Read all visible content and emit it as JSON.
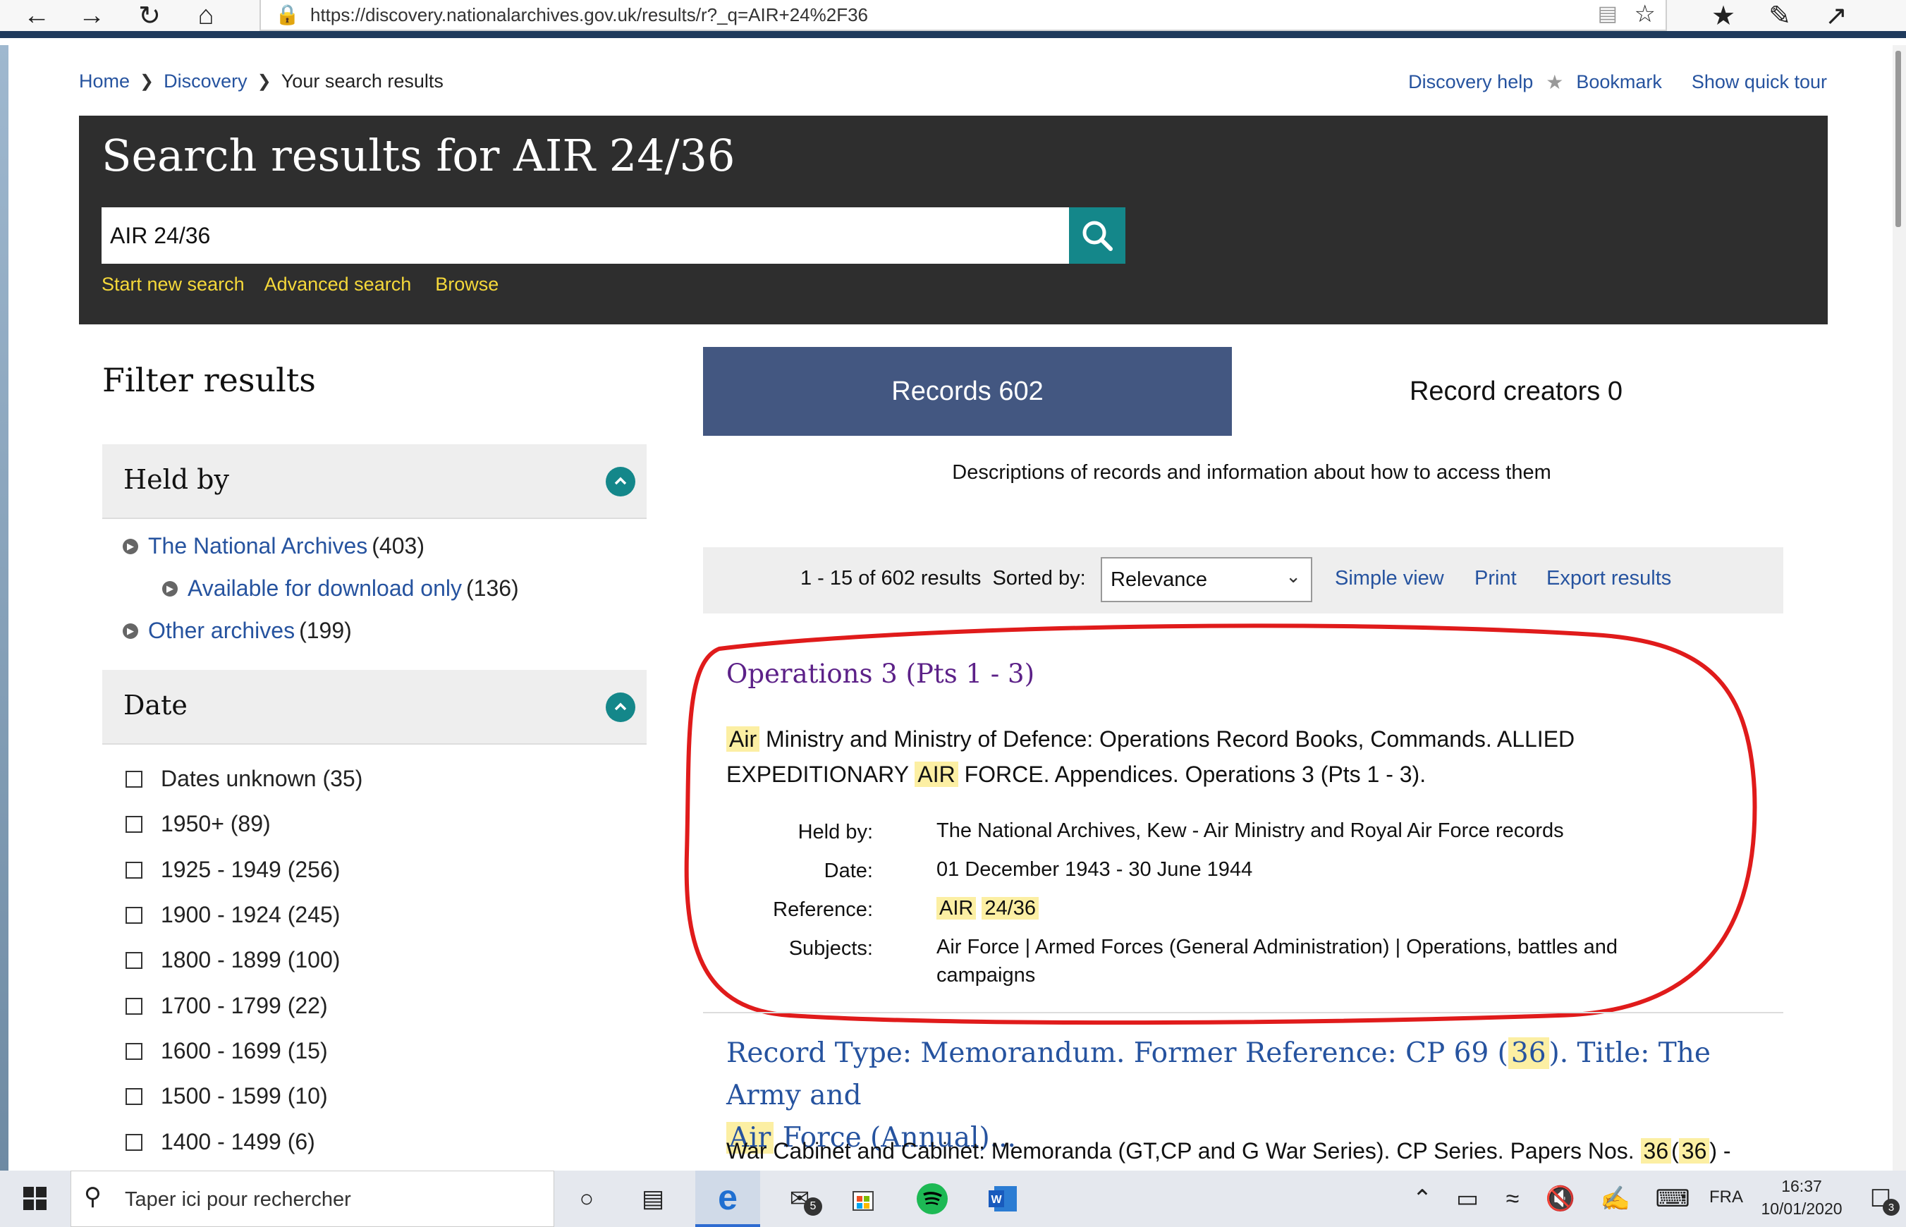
{
  "browser": {
    "url": "https://discovery.nationalarchives.gov.uk/results/r?_q=AIR+24%2F36"
  },
  "breadcrumb": {
    "home": "Home",
    "discovery": "Discovery",
    "current": "Your search results"
  },
  "topnav": {
    "help": "Discovery help",
    "bookmark": "Bookmark",
    "tour": "Show quick tour"
  },
  "hero": {
    "title": "Search results for AIR 24/36",
    "search_value": "AIR 24/36",
    "links": [
      "Start new search",
      "Advanced search",
      "Browse"
    ]
  },
  "filter": {
    "title": "Filter results",
    "held_by": {
      "heading": "Held by",
      "items": [
        {
          "label": "The National Archives",
          "count": "(403)"
        },
        {
          "label": "Available for download only",
          "count": "(136)"
        },
        {
          "label": "Other archives",
          "count": "(199)"
        }
      ]
    },
    "date": {
      "heading": "Date",
      "items": [
        "Dates unknown (35)",
        "1950+ (89)",
        "1925 - 1949 (256)",
        "1900 - 1924 (245)",
        "1800 - 1899 (100)",
        "1700 - 1799 (22)",
        "1600 - 1699 (15)",
        "1500 - 1599 (10)",
        "1400 - 1499 (6)"
      ]
    }
  },
  "tabs": {
    "records": "Records 602",
    "creators": "Record creators 0",
    "description": "Descriptions of records and information about how to access them"
  },
  "toolbar": {
    "count": "1 - 15 of 602 results",
    "sorted_label": "Sorted by:",
    "sort_value": "Relevance",
    "simple_view": "Simple view",
    "print": "Print",
    "export": "Export results"
  },
  "result1": {
    "title": "Operations 3 (Pts 1 - 3)",
    "desc": {
      "hl1": "Air",
      "t1": "Ministry and Ministry of Defence: Operations Record Books, Commands. ALLIED",
      "t2": "EXPEDITIONARY",
      "hl2": "AIR",
      "t3": "FORCE. Appendices. Operations 3 (Pts 1 - 3)."
    },
    "labels": {
      "held_by": "Held by:",
      "date": "Date:",
      "reference": "Reference:",
      "subjects": "Subjects:"
    },
    "held_by": "The National Archives, Kew - Air Ministry and Royal Air Force records",
    "date": "01 December 1943 - 30 June 1944",
    "reference_1": "AIR",
    "reference_2": "24/36",
    "subjects_line1": "Air Force | Armed Forces (General Administration) | Operations, battles and",
    "subjects_line2": "campaigns"
  },
  "result2": {
    "title_a": "Record Type: Memorandum. Former Reference: CP 69 (",
    "title_hl1": "36",
    "title_b": "). Title: The Army and",
    "title_hl2": "Air",
    "title_c": "Force (Annual)...",
    "desc_a": "War Cabinet and Cabinet: Memoranda (GT,CP and G War Series). CP Series. Papers Nos.",
    "desc_hl1": "36",
    "desc_paren_open": "(",
    "desc_hl2": "36",
    "desc_b": ") -"
  },
  "taskbar": {
    "search_placeholder": "Taper ici pour rechercher",
    "mail_badge": "5",
    "lang": "FRA",
    "time": "16:37",
    "date": "10/01/2020",
    "notif_badge": "3"
  }
}
